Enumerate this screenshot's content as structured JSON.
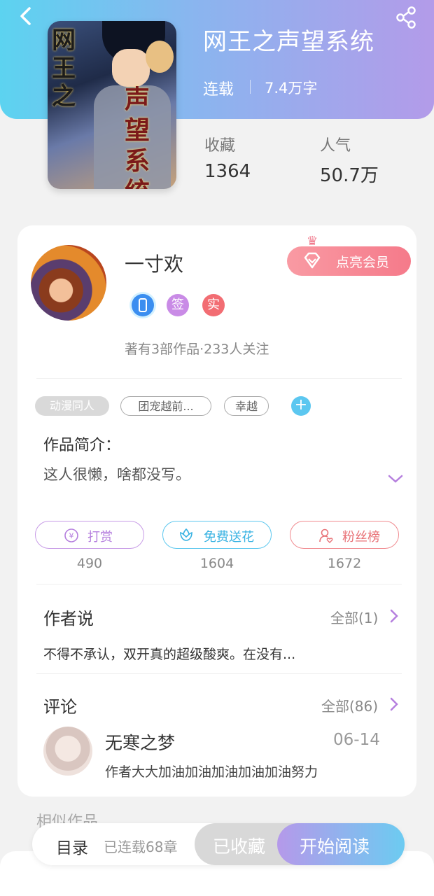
{
  "book": {
    "title": "网王之声望系统",
    "cover_text_1": "网王之",
    "cover_text_2": "声望系统",
    "status": "连载",
    "word_count": "7.4万字",
    "stats": [
      {
        "label": "收藏",
        "value": "1364"
      },
      {
        "label": "人气",
        "value": "50.7万"
      }
    ]
  },
  "author": {
    "name": "一寸欢",
    "vip_button": "点亮会员",
    "badges": [
      "",
      "签",
      "实"
    ],
    "summary": "著有3部作品·233人关注"
  },
  "tags": [
    "动漫同人",
    "团宠越前...",
    "幸越"
  ],
  "intro": {
    "heading": "作品简介：",
    "text": "这人很懒，啥都没写。"
  },
  "actions": [
    {
      "label": "打赏",
      "count": "490",
      "icon": "yen-coin-icon",
      "color": "#b57fde"
    },
    {
      "label": "免费送花",
      "count": "1604",
      "icon": "flower-icon",
      "color": "#37b2e2"
    },
    {
      "label": "粉丝榜",
      "count": "1672",
      "icon": "fan-user-icon",
      "color": "#e87277"
    }
  ],
  "author_says": {
    "heading": "作者说",
    "all": "全部(1)",
    "snippet": "不得不承认，双开真的超级酸爽。在没有..."
  },
  "comments": {
    "heading": "评论",
    "all": "全部(86)",
    "items": [
      {
        "user": "无寒之梦",
        "date": "06-14",
        "text": "作者大大加油加油加油加油加油努力"
      }
    ]
  },
  "similar_heading": "相似作品",
  "bottom_bar": {
    "toc": "目录",
    "chapters": "已连载68章",
    "favorited": "已收藏",
    "start_reading": "开始阅读"
  },
  "colors": {
    "header_gradient_start": "#5cd3f0",
    "header_gradient_end": "#b39be9",
    "vip": "#f57a8a"
  }
}
